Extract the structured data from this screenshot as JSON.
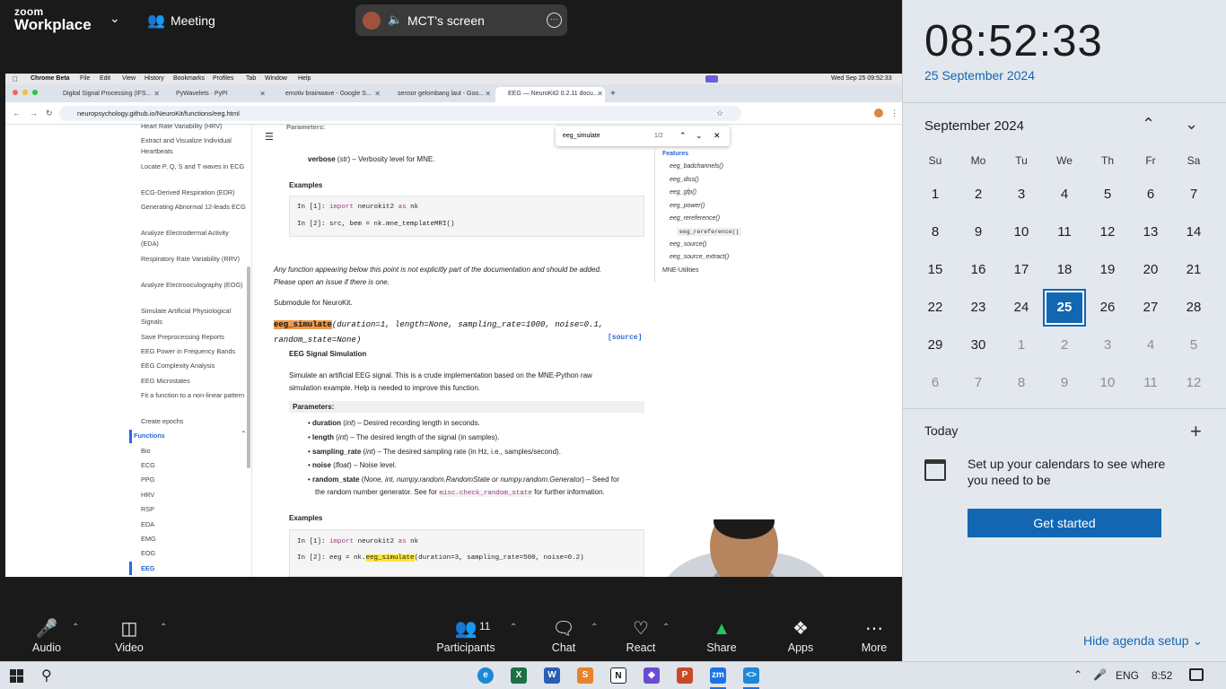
{
  "zoom": {
    "logo_top": "zoom",
    "logo_bottom": "Workplace",
    "meeting_label": "Meeting",
    "share_title": "MCT's screen",
    "toolbar": {
      "audio": "Audio",
      "video": "Video",
      "participants": "Participants",
      "participant_count": "11",
      "chat": "Chat",
      "react": "React",
      "share": "Share",
      "apps": "Apps",
      "more": "More"
    }
  },
  "mac": {
    "app": "Chrome Beta",
    "menus": [
      "File",
      "Edit",
      "View",
      "History",
      "Bookmarks",
      "Profiles",
      "Tab",
      "Window",
      "Help"
    ],
    "clock": "Wed Sep 25  09:52:33"
  },
  "browser": {
    "tabs": [
      "Digital Signal Processing (IFS...",
      "PyWavelets · PyPI",
      "emotiv brainwave - Google S...",
      "sensor gelombang laut - Goo...",
      "EEG — NeuroKit2 0.2.11 docu..."
    ],
    "url": "neuropsychology.github.io/NeuroKit/functions/eeg.html",
    "find_query": "eeg_simulate",
    "find_count": "1/2"
  },
  "sidebar": {
    "items": [
      "Heart Rate Variability (HRV)",
      "Extract and Visualize Individual Heartbeats",
      "Locate P, Q, S and T waves in ECG",
      "ECG-Derived Respiration (EDR)",
      "Generating Abnormal 12-leads ECG",
      "Analyze Electrodermal Activity (EDA)",
      "Respiratory Rate Variability (RRV)",
      "Analyze Electrooculography (EOG)",
      "Simulate Artificial Physiological Signals",
      "Save Preprocessing Reports",
      "EEG Power in Frequency Bands",
      "EEG Complexity Analysis",
      "EEG Microstates",
      "Fit a function to a non-linear pattern",
      "Create epochs"
    ],
    "section": "Functions",
    "functions": [
      "Bio",
      "ECG",
      "PPG",
      "HRV",
      "RSP",
      "EDA",
      "EMG",
      "EOG",
      "EEG"
    ]
  },
  "doc": {
    "params_label": "Parameters:",
    "verbose_name": "verbose",
    "verbose_type": "str",
    "verbose_desc": " – Verbosity level for MNE.",
    "examples": "Examples",
    "ex1_prompt": "In [1]:",
    "ex1_kw": "import",
    "ex1_mod": "neurokit2",
    "ex1_as": "as",
    "ex1_alias": "nk",
    "ex2_prompt": "In [2]:",
    "ex2_code": "src, bem = nk.mne_templateMRI()",
    "notice_1": "Any function appearing below this point is not explicitly part of the documentation and should be added.",
    "notice_2": "Please open an issue if there is one.",
    "submodule": "Submodule for NeuroKit.",
    "func_name": "eeg_simulate",
    "sig_line1": "(duration=1, length=None, sampling_rate=1000, noise=0.1,",
    "sig_line2": "random_state=None)",
    "source_link": "[source]",
    "func_title": "EEG Signal Simulation",
    "desc_1": "Simulate an artificial EEG signal. This is a crude implementation based on the MNE-Python raw",
    "desc_2": "simulation example. Help is needed to improve this function.",
    "params": [
      {
        "name": "duration",
        "type": "int",
        "desc": " – Desired recording length in seconds."
      },
      {
        "name": "length",
        "type": "int",
        "desc": " – The desired length of the signal (in samples)."
      },
      {
        "name": "sampling_rate",
        "type": "int",
        "desc": " – The desired sampling rate (in Hz, i.e., samples/second)."
      },
      {
        "name": "noise",
        "type": "float",
        "desc": " – Noise level."
      },
      {
        "name": "random_state",
        "type": "None, int, numpy.random.RandomState or numpy.random.Generator",
        "desc": " – Seed for"
      }
    ],
    "random_state_line2a": "the random number generator. See for ",
    "random_state_code": "misc.check_random_state",
    "random_state_line2b": " for further information.",
    "ex3_code_a": "eeg = nk.",
    "ex3_code_hl": "eeg_simulate",
    "ex3_code_b": "(duration=3, sampling_rate=500, noise=0.2)"
  },
  "toc": {
    "heading": "Features",
    "items": [
      "eeg_badchannels()",
      "eeg_diss()",
      "eeg_gfp()",
      "eeg_power()",
      "eeg_rereference()",
      "eeg_rereference()",
      "eeg_source()",
      "eeg_source_extract()"
    ],
    "footer": "MNE-Utilities"
  },
  "calendar": {
    "time": "08:52:33",
    "date": "25 September 2024",
    "month": "September 2024",
    "weekdays": [
      "Su",
      "Mo",
      "Tu",
      "We",
      "Th",
      "Fr",
      "Sa"
    ],
    "days": [
      1,
      2,
      3,
      4,
      5,
      6,
      7,
      8,
      9,
      10,
      11,
      12,
      13,
      14,
      15,
      16,
      17,
      18,
      19,
      20,
      21,
      22,
      23,
      24,
      25,
      26,
      27,
      28,
      29,
      30,
      1,
      2,
      3,
      4,
      5,
      6,
      7,
      8,
      9,
      10,
      11,
      12
    ],
    "selected_day": 25,
    "today_label": "Today",
    "message": "Set up your calendars to see where you need to be",
    "get_started": "Get started",
    "hide_agenda": "Hide agenda setup"
  },
  "taskbar": {
    "language": "ENG",
    "time": "8:52"
  }
}
